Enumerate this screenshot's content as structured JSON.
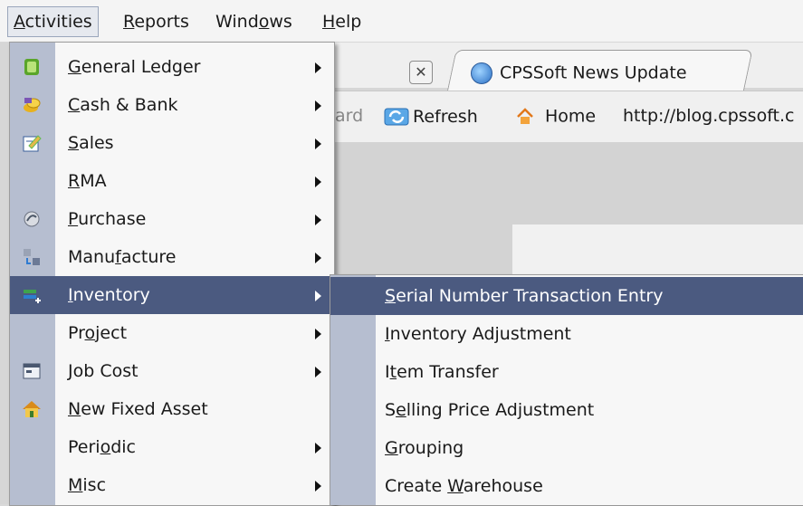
{
  "menubar": {
    "items": [
      {
        "label": "Activities",
        "underline": "A",
        "rest": "ctivities"
      },
      {
        "label": "Reports",
        "underline": "R",
        "rest": "eports"
      },
      {
        "label": "Windows",
        "pre": "Wind",
        "underline": "o",
        "rest": "ws"
      },
      {
        "label": "Help",
        "underline": "H",
        "rest": "elp"
      }
    ]
  },
  "browser": {
    "tab_title": "CPSSoft News Update",
    "forward_label": "ard",
    "refresh_label": "Refresh",
    "home_label": "Home",
    "url": "http://blog.cpssoft.c"
  },
  "activities_menu": {
    "items": [
      {
        "pre": "",
        "u": "G",
        "post": "eneral Ledger",
        "icon": "ledger-icon",
        "submenu": true
      },
      {
        "pre": "",
        "u": "C",
        "post": "ash & Bank",
        "icon": "cash-bank-icon",
        "submenu": true
      },
      {
        "pre": "",
        "u": "S",
        "post": "ales",
        "icon": "sales-icon",
        "submenu": true
      },
      {
        "pre": "",
        "u": "R",
        "post": "MA",
        "icon": "",
        "submenu": true
      },
      {
        "pre": "",
        "u": "P",
        "post": "urchase",
        "icon": "purchase-icon",
        "submenu": true
      },
      {
        "pre": "Manu",
        "u": "f",
        "post": "acture",
        "icon": "manufacture-icon",
        "submenu": true
      },
      {
        "pre": "",
        "u": "I",
        "post": "nventory",
        "icon": "inventory-icon",
        "submenu": true
      },
      {
        "pre": "Pr",
        "u": "o",
        "post": "ject",
        "icon": "",
        "submenu": true
      },
      {
        "pre": "",
        "u": "J",
        "post": "ob Cost",
        "icon": "job-cost-icon",
        "submenu": true
      },
      {
        "pre": "",
        "u": "N",
        "post": "ew Fixed Asset",
        "icon": "fixed-asset-icon",
        "submenu": false
      },
      {
        "pre": "Peri",
        "u": "o",
        "post": "dic",
        "icon": "",
        "submenu": true
      },
      {
        "pre": "",
        "u": "M",
        "post": "isc",
        "icon": "",
        "submenu": true
      }
    ]
  },
  "inventory_submenu": {
    "items": [
      {
        "pre": "",
        "u": "S",
        "post": "erial Number Transaction Entry"
      },
      {
        "pre": "",
        "u": "I",
        "post": "nventory Adjustment"
      },
      {
        "pre": "I",
        "u": "t",
        "post": "em Transfer"
      },
      {
        "pre": "S",
        "u": "e",
        "post": "lling Price Adjustment"
      },
      {
        "pre": "",
        "u": "G",
        "post": "rouping"
      },
      {
        "pre": "Create ",
        "u": "W",
        "post": "arehouse"
      }
    ]
  },
  "colors": {
    "highlight": "#4b5a80",
    "gutter": "#b6bed0"
  }
}
